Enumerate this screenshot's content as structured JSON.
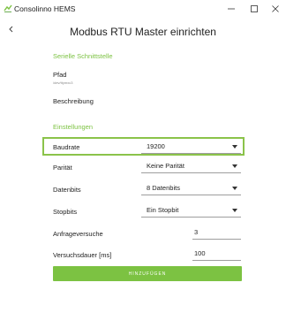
{
  "window": {
    "app_title": "Consolinno HEMS"
  },
  "page": {
    "title": "Modbus RTU Master einrichten"
  },
  "serial": {
    "header": "Serielle Schnittstelle",
    "path_label": "Pfad",
    "path_value": "/dev/ttymxc3",
    "description_label": "Beschreibung"
  },
  "settings": {
    "header": "Einstellungen",
    "baudrate_label": "Baudrate",
    "baudrate_value": "19200",
    "parity_label": "Parität",
    "parity_value": "Keine Parität",
    "databits_label": "Datenbits",
    "databits_value": "8 Datenbits",
    "stopbits_label": "Stopbits",
    "stopbits_value": "Ein Stopbit",
    "attempts_label": "Anfrageversuche",
    "attempts_value": "3",
    "duration_label": "Versuchsdauer [ms]",
    "duration_value": "100"
  },
  "actions": {
    "add_label": "HINZUFÜGEN"
  },
  "colors": {
    "accent": "#7cc242",
    "highlight_border": "#8bc34a"
  },
  "icons": {
    "app": "app-icon",
    "back": "back-arrow-icon",
    "minimize": "minimize-icon",
    "maximize": "maximize-icon",
    "close": "close-icon",
    "caret": "caret-down-icon"
  }
}
